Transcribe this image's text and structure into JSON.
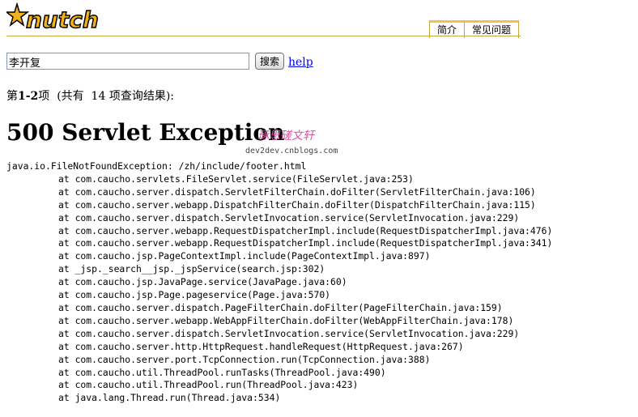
{
  "header": {
    "logo_text": "nutch",
    "tabs": [
      {
        "label": "简介"
      },
      {
        "label": "常见问题"
      }
    ]
  },
  "search": {
    "query": "李开复",
    "button_label": "搜索",
    "help_label": "help"
  },
  "results": {
    "prefix": "第",
    "range": "1-2",
    "suffix": "项  (共有  14 项查询结果):"
  },
  "error": {
    "title": "500 Servlet Exception",
    "watermark_cn": "琢思磋文轩",
    "watermark_url": "dev2dev.cnblogs.com",
    "exception": "java.io.FileNotFoundException: /zh/include/footer.html",
    "trace": [
      "at com.caucho.servlets.FileServlet.service(FileServlet.java:253)",
      "at com.caucho.server.dispatch.ServletFilterChain.doFilter(ServletFilterChain.java:106)",
      "at com.caucho.server.webapp.DispatchFilterChain.doFilter(DispatchFilterChain.java:115)",
      "at com.caucho.server.dispatch.ServletInvocation.service(ServletInvocation.java:229)",
      "at com.caucho.server.webapp.RequestDispatcherImpl.include(RequestDispatcherImpl.java:476)",
      "at com.caucho.server.webapp.RequestDispatcherImpl.include(RequestDispatcherImpl.java:341)",
      "at com.caucho.jsp.PageContextImpl.include(PageContextImpl.java:897)",
      "at _jsp._search__jsp._jspService(search.jsp:302)",
      "at com.caucho.jsp.JavaPage.service(JavaPage.java:60)",
      "at com.caucho.jsp.Page.pageservice(Page.java:570)",
      "at com.caucho.server.dispatch.PageFilterChain.doFilter(PageFilterChain.java:159)",
      "at com.caucho.server.webapp.WebAppFilterChain.doFilter(WebAppFilterChain.java:178)",
      "at com.caucho.server.dispatch.ServletInvocation.service(ServletInvocation.java:229)",
      "at com.caucho.server.http.HttpRequest.handleRequest(HttpRequest.java:267)",
      "at com.caucho.server.port.TcpConnection.run(TcpConnection.java:388)",
      "at com.caucho.util.ThreadPool.runTasks(ThreadPool.java:490)",
      "at com.caucho.util.ThreadPool.run(ThreadPool.java:423)",
      "at java.lang.Thread.run(Thread.java:534)"
    ]
  }
}
